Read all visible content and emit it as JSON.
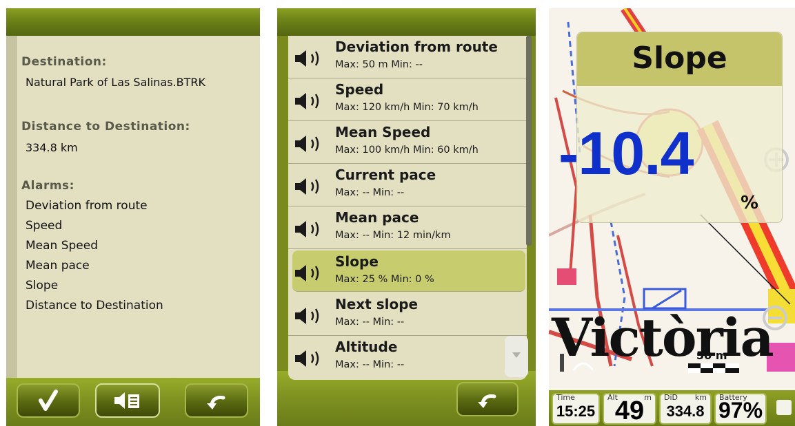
{
  "screen1": {
    "destination_label": "Destination:",
    "destination_value": "Natural Park of Las Salinas.BTRK",
    "distance_label": "Distance to Destination:",
    "distance_value": "334.8 km",
    "alarms_label": "Alarms:",
    "alarms": [
      "Deviation from route",
      "Speed",
      "Mean Speed",
      "Mean pace",
      "Slope",
      "Distance to Destination"
    ],
    "buttons": {
      "confirm": "check-icon",
      "alarms": "speaker-list-icon",
      "back": "back-arrow-icon"
    }
  },
  "screen2": {
    "items": [
      {
        "title": "Deviation from route",
        "sub": "Max: 50 m Min: --",
        "selected": false
      },
      {
        "title": "Speed",
        "sub": "Max: 120 km/h Min: 70 km/h",
        "selected": false
      },
      {
        "title": "Mean Speed",
        "sub": "Max: 100 km/h Min: 60 km/h",
        "selected": false
      },
      {
        "title": "Current pace",
        "sub": "Max: -- Min: --",
        "selected": false
      },
      {
        "title": "Mean pace",
        "sub": "Max: -- Min: 12 min/km",
        "selected": false
      },
      {
        "title": "Slope",
        "sub": "Max: 25 % Min: 0 %",
        "selected": true
      },
      {
        "title": "Next slope",
        "sub": "Max: -- Min: --",
        "selected": false
      },
      {
        "title": "Altitude",
        "sub": "Max: -- Min: --",
        "selected": false
      }
    ],
    "back_icon": "back-arrow-icon"
  },
  "screen3": {
    "slope_title": "Slope",
    "slope_value": "-10.4",
    "slope_unit": "%",
    "map_label": "Victòria",
    "scale_label": "50 m",
    "status": [
      {
        "label": "Time",
        "unit": "",
        "value": "15:25"
      },
      {
        "label": "Alt",
        "unit": "m",
        "value": "49"
      },
      {
        "label": "DiD",
        "unit": "km",
        "value": "334.8"
      },
      {
        "label": "Battery",
        "unit": "",
        "value": "97%"
      }
    ],
    "colors": {
      "accent": "#7a8a1c",
      "value_blue": "#1030cc",
      "highlight": "#c7cc6e"
    }
  }
}
